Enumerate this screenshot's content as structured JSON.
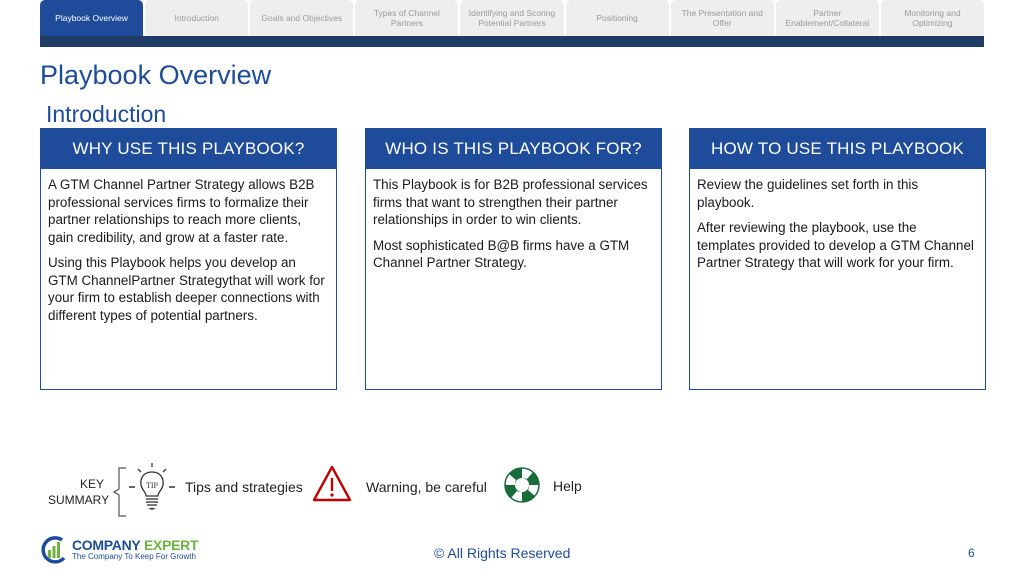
{
  "tabs": [
    {
      "label": "Playbook Overview",
      "active": true
    },
    {
      "label": "Introduction",
      "active": false
    },
    {
      "label": "Goals and Objectives",
      "active": false
    },
    {
      "label": "Types of Channel Partners",
      "active": false
    },
    {
      "label": "Identifying and Scoring Potential Partners",
      "active": false
    },
    {
      "label": "Positioning",
      "active": false
    },
    {
      "label": "The Presentation and Offer",
      "active": false
    },
    {
      "label": "Partner Enablement/Collateral",
      "active": false
    },
    {
      "label": "Monitoring and Optimizing",
      "active": false
    }
  ],
  "page": {
    "title": "Playbook Overview",
    "subtitle": "Introduction"
  },
  "cards": [
    {
      "heading": "WHY USE THIS PLAYBOOK?",
      "paragraphs": [
        "A GTM Channel Partner Strategy allows B2B professional services firms to formalize their partner relationships to reach more clients, gain credibility, and grow at a faster rate.",
        "Using this Playbook helps you develop an GTM ChannelPartner Strategythat will work for your firm to establish deeper connections with different types of potential partners."
      ]
    },
    {
      "heading": "WHO IS THIS PLAYBOOK FOR?",
      "paragraphs": [
        "This Playbook is for B2B professional services firms that want to strengthen their partner relationships in order to win clients.",
        "Most sophisticated B@B firms have a GTM Channel Partner Strategy."
      ]
    },
    {
      "heading": "HOW TO USE THIS PLAYBOOK",
      "paragraphs": [
        "Review the guidelines set forth in this playbook.",
        "After reviewing the playbook, use the templates provided to develop a GTM Channel Partner Strategy that will work for your firm."
      ]
    }
  ],
  "key_summary": {
    "label_line1": "KEY",
    "label_line2": "SUMMARY",
    "tip_icon_text": "TIP",
    "tips": "Tips and strategies",
    "warning": "Warning, be careful",
    "help": "Help"
  },
  "footer": {
    "logo_name_a": "COMPANY",
    "logo_name_b": "EXPERT",
    "logo_tagline": "The Company To Keep For Growth",
    "copyright": "© All Rights Reserved",
    "page_number": "6"
  },
  "colors": {
    "brand_blue": "#1e4c9a",
    "strip_navy": "#1f3b63",
    "tab_inactive": "#eeeeee",
    "warning_red": "#c00000",
    "help_green": "#1a6b3a",
    "logo_green": "#6cb33f"
  }
}
